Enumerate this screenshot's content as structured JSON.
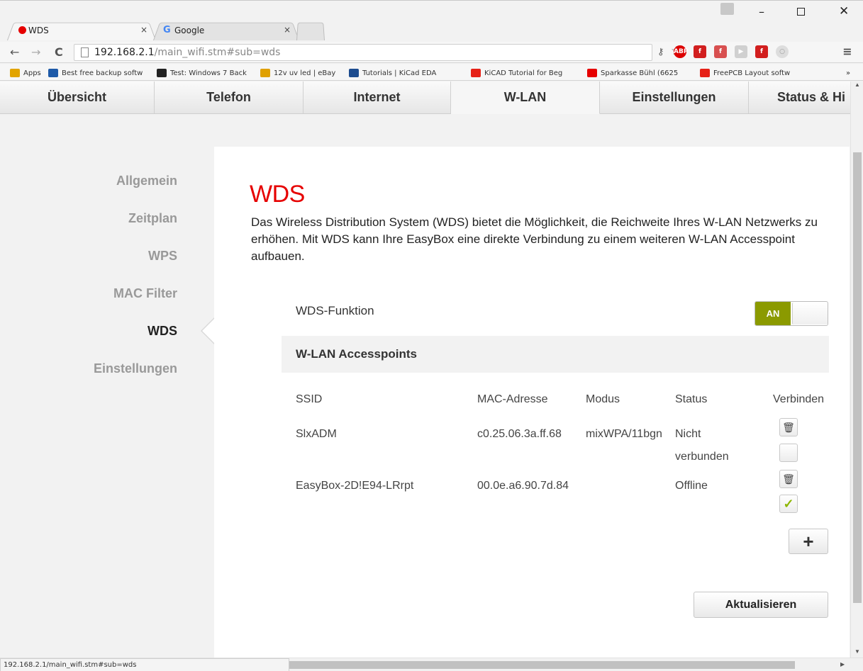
{
  "browser": {
    "tabs": [
      {
        "title": "WDS",
        "close": "×"
      },
      {
        "title": "Google",
        "close": "×"
      }
    ],
    "url_host": "192.168.2.1",
    "url_path": "/main_wifi.stm#sub=wds",
    "bookmarks": [
      {
        "label": "Apps",
        "color": "#e2a400"
      },
      {
        "label": "Best free backup softw",
        "color": "#1e5aa8"
      },
      {
        "label": "Test: Windows 7 Back",
        "color": "#222222"
      },
      {
        "label": "12v uv led | eBay",
        "color": "#e0a000"
      },
      {
        "label": "Tutorials | KiCad EDA",
        "color": "#1d4c8f"
      },
      {
        "label": "KiCAD Tutorial for Beg",
        "color": "#e62117"
      },
      {
        "label": "Sparkasse Bühl (6625",
        "color": "#e60000"
      },
      {
        "label": "FreePCB Layout softw",
        "color": "#e62117"
      }
    ],
    "bookmarks_overflow": "»",
    "status_url": "192.168.2.1/main_wifi.stm#sub=wds",
    "extension_labels": {
      "abp": "ABP"
    }
  },
  "nav": {
    "tabs": [
      "Übersicht",
      "Telefon",
      "Internet",
      "W-LAN",
      "Einstellungen",
      "Status & Hi"
    ],
    "active": "W-LAN"
  },
  "sidebar": {
    "items": [
      "Allgemein",
      "Zeitplan",
      "WPS",
      "MAC Filter",
      "WDS",
      "Einstellungen"
    ],
    "active": "WDS"
  },
  "content": {
    "title": "WDS",
    "description": "Das Wireless Distribution System (WDS) bietet die Möglichkeit, die Reichweite Ihres W-LAN Netzwerks zu erhöhen. Mit WDS kann Ihre EasyBox eine direkte Verbindung zu einem weiteren W-LAN Accesspoint aufbauen.",
    "wds_label": "WDS-Funktion",
    "toggle_label": "AN",
    "toggle_state": true,
    "ap_section_title": "W-LAN Accesspoints",
    "table": {
      "headers": [
        "SSID",
        "MAC-Adresse",
        "Modus",
        "Status",
        "Verbinden"
      ],
      "rows": [
        {
          "ssid": "SlxADM",
          "mac": "c0.25.06.3a.ff.68",
          "mode": "mixWPA/11bgn",
          "status": "Nicht verbunden",
          "connected": false
        },
        {
          "ssid": "EasyBox-2D!E94-LRrpt",
          "mac": "00.0e.a6.90.7d.84",
          "mode": "",
          "status": "Offline",
          "connected": true
        }
      ]
    },
    "add_label": "+",
    "refresh_label": "Aktualisieren"
  },
  "colors": {
    "accent_red": "#e60000",
    "toggle_green": "#8b9a00",
    "check_green": "#8db600"
  }
}
